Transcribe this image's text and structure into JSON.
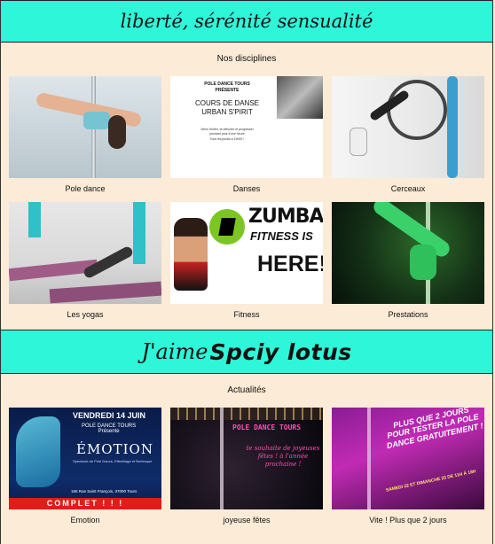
{
  "banner_top": {
    "title": "liberté, sérénité sensualité"
  },
  "disciplines": {
    "heading": "Nos disciplines",
    "items": [
      {
        "label": "Pole dance"
      },
      {
        "label": "Danses"
      },
      {
        "label": "Cerceaux"
      },
      {
        "label": "Les yogas"
      },
      {
        "label": "Fitness"
      },
      {
        "label": "Prestations"
      }
    ],
    "danse_poster": {
      "line1": "POLE DANCE TOURS",
      "line2": "PRÉSENTE",
      "title1": "COURS DE DANSE",
      "title2": "URBAN S'PIRIT",
      "sub1": "Viens t'initier, te défouler et progresser",
      "sub2": "pendant plus d'une heure",
      "sub3": "Tous les jeudis à 19h00 !"
    },
    "zumba_poster": {
      "word": "ZUMBA",
      "fitness": "FITNESS",
      "is": "IS",
      "here": "HERE!"
    }
  },
  "banner_brand": {
    "script": "J'aime",
    "bold": "Spciy lotus"
  },
  "actualites": {
    "heading": "Actualités",
    "items": [
      {
        "label": "Emotion"
      },
      {
        "label": "joyeuse fêtes"
      },
      {
        "label": "Vite ! Plus que 2 jours"
      }
    ],
    "emotion_poster": {
      "date": "VENDREDI 14 JUIN",
      "org": "POLE DANCE TOURS",
      "presente": "Présente",
      "title": "ÉMOTION",
      "sub": "Spectacle de Pole Dance, Effeuillage et Burlesque",
      "addr": "155 Rue Saint François, 37000 Tours",
      "complet": "COMPLET ! ! !"
    },
    "fetes_poster": {
      "title": "POLE DANCE TOURS",
      "wish": "te souhaite de joyeuses fêtes ! à l'année prochaine !"
    },
    "vite_poster": {
      "text": "PLUS QUE 2 JOURS POUR TESTER LA POLE DANCE GRATUITEMENT !",
      "dates": "SAMEDI 22 ET DIMANCHE 23 DE 11H À 18H"
    }
  },
  "colors": {
    "banner": "#2ef7d9",
    "background": "#fcebd6",
    "complet": "#e21b1b"
  }
}
